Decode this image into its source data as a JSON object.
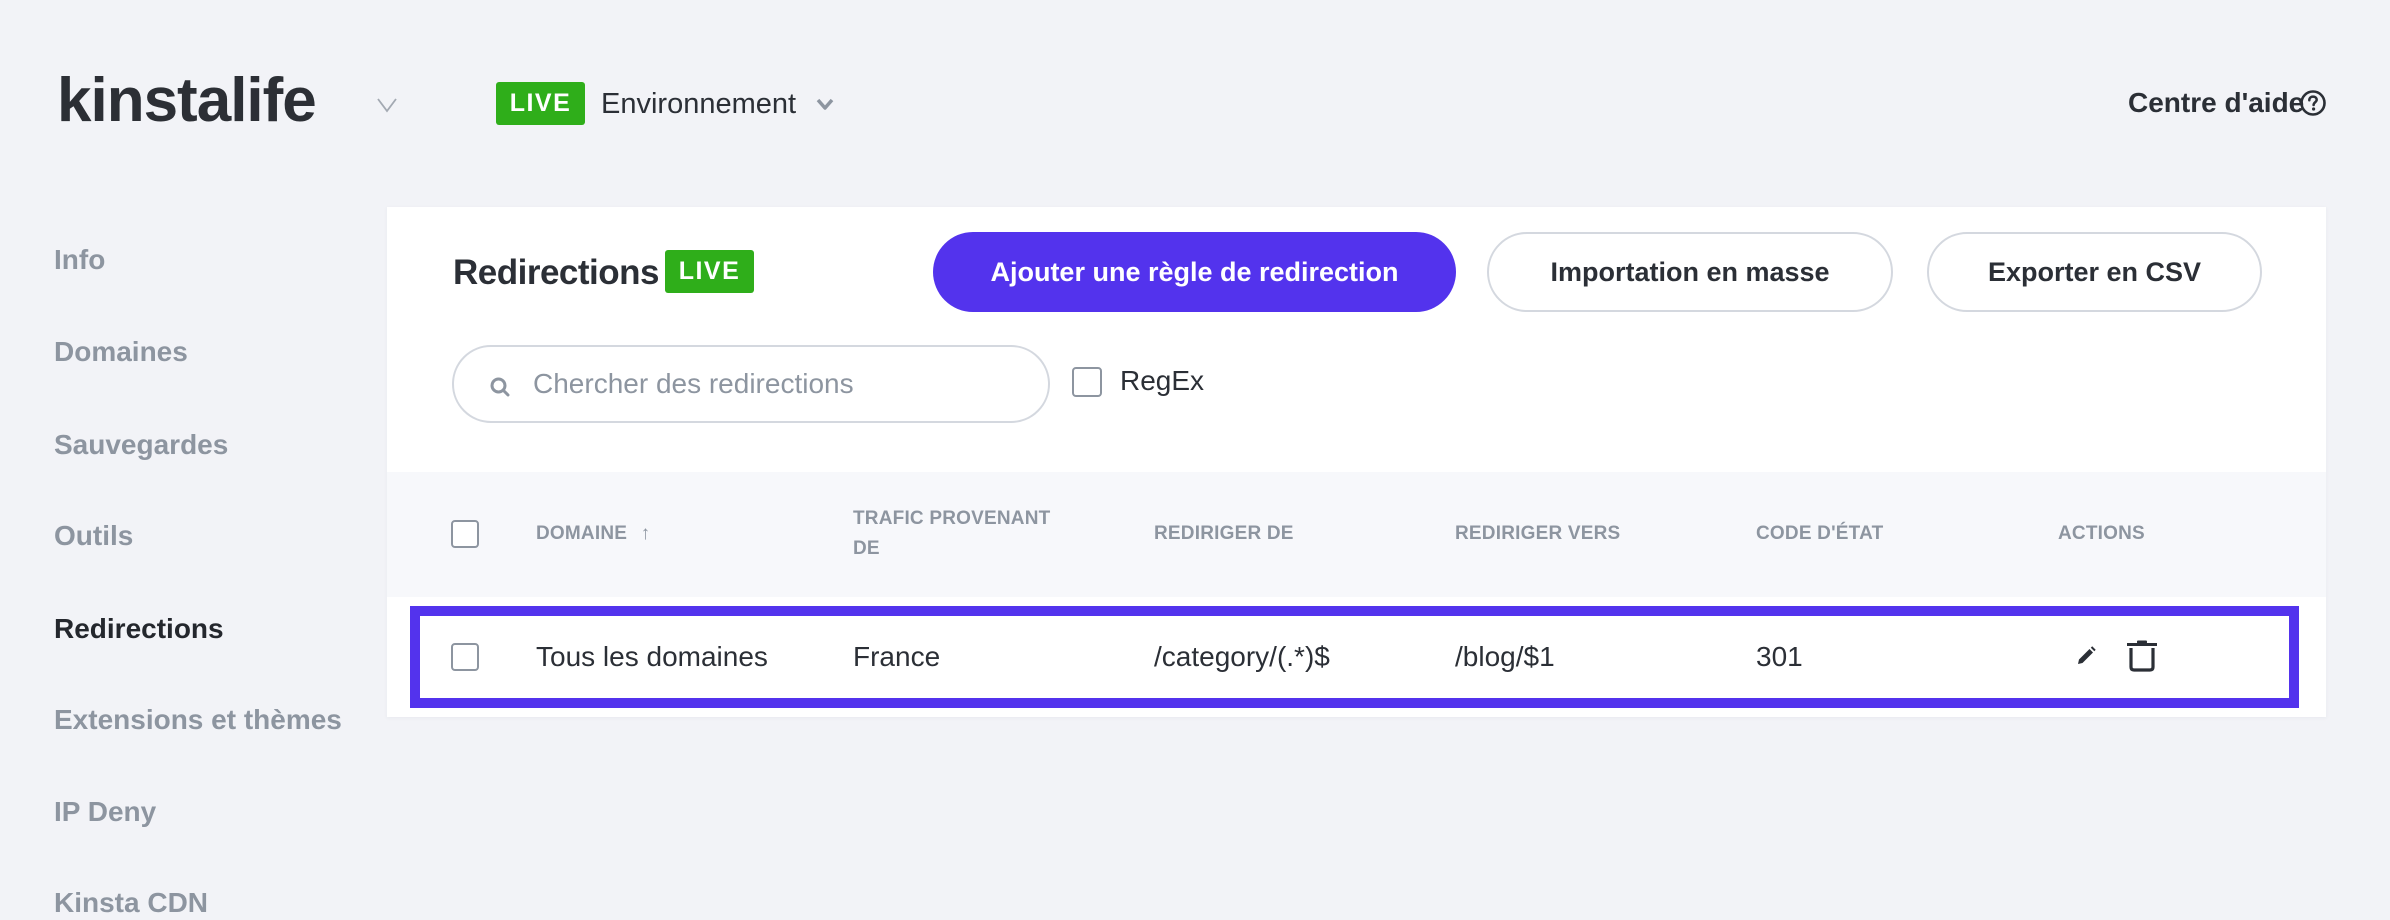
{
  "header": {
    "site_name": "kinstalife",
    "site_switcher_icon": "chevron-down-icon",
    "environment_badge": "LIVE",
    "environment_label": "Environnement",
    "environment_icon": "chevron-down-icon",
    "help_label": "Centre d'aide",
    "help_icon": "question-circle-icon"
  },
  "sidebar": {
    "items": [
      {
        "label": "Info",
        "active": false
      },
      {
        "label": "Domaines",
        "active": false
      },
      {
        "label": "Sauvegardes",
        "active": false
      },
      {
        "label": "Outils",
        "active": false
      },
      {
        "label": "Redirections",
        "active": true
      },
      {
        "label": "Extensions et thèmes",
        "active": false
      },
      {
        "label": "IP Deny",
        "active": false
      },
      {
        "label": "Kinsta CDN",
        "active": false
      }
    ]
  },
  "main": {
    "title": "Redirections",
    "badge": "LIVE",
    "buttons": {
      "add_rule": "Ajouter une règle de redirection",
      "bulk_import": "Importation en masse",
      "export_csv": "Exporter en CSV"
    },
    "search": {
      "placeholder": "Chercher des redirections",
      "value": ""
    },
    "regex": {
      "label": "RegEx",
      "checked": false
    },
    "table": {
      "columns": [
        {
          "label": "DOMAINE",
          "sort": "ascending",
          "sort_icon": "arrow-up-icon"
        },
        {
          "label": "TRAFIC PROVENANT DE",
          "line1": "TRAFIC PROVENANT",
          "line2": "DE"
        },
        {
          "label": "REDIRIGER DE"
        },
        {
          "label": "REDIRIGER VERS"
        },
        {
          "label": "CODE D'ÉTAT"
        },
        {
          "label": "ACTIONS"
        }
      ],
      "sort_arrow": "↑",
      "rows": [
        {
          "selected": false,
          "domain": "Tous les domaines",
          "traffic_from": "France",
          "redirect_from": "/category/(.*)$",
          "redirect_to": "/blog/$1",
          "status_code": "301",
          "actions": [
            "edit-icon",
            "trash-icon"
          ],
          "highlighted": true
        }
      ]
    }
  },
  "colors": {
    "accent": "#5333ed",
    "live_green": "#2fae1a",
    "background": "#f2f3f7",
    "muted_text": "#8d95a0",
    "text": "#2b2f36"
  }
}
